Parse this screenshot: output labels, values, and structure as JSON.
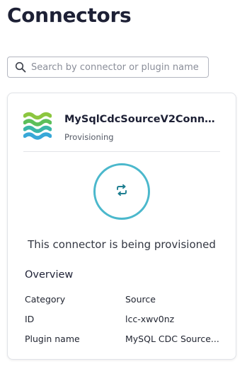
{
  "page": {
    "title": "Connectors"
  },
  "search": {
    "placeholder": "Search by connector or plugin name",
    "value": ""
  },
  "connector_card": {
    "name": "MySqlCdcSourceV2Connect...",
    "status": "Provisioning",
    "status_message": "This connector is being provisioned",
    "icons": {
      "logo": "connector-logo-icon",
      "status": "sync-icon"
    },
    "colors": {
      "ring": "#4bb8cc",
      "logo_green": "#8cc63f",
      "logo_teal": "#3ab6a8",
      "logo_blue": "#38a8d8"
    },
    "overview": {
      "title": "Overview",
      "rows": [
        {
          "label": "Category",
          "value": "Source"
        },
        {
          "label": "ID",
          "value": "lcc-xwv0nz"
        },
        {
          "label": "Plugin name",
          "value": "MySQL CDC Source..."
        }
      ]
    }
  }
}
